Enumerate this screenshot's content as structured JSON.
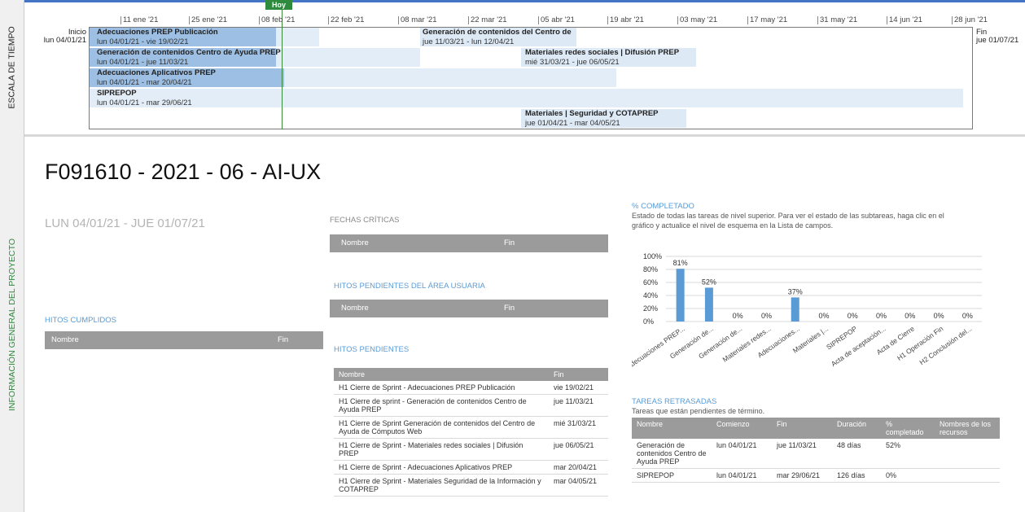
{
  "timeline": {
    "side_label": "ESCALA DE TIEMPO",
    "today_label": "Hoy",
    "start_label": "Inicio",
    "start_date": "lun 04/01/21",
    "end_label": "Fin",
    "end_date": "jue 01/07/21",
    "ticks": [
      "11 ene '21",
      "25 ene '21",
      "08 feb '21",
      "22 feb '21",
      "08 mar '21",
      "22 mar '21",
      "05 abr '21",
      "19 abr '21",
      "03 may '21",
      "17 may '21",
      "31 may '21",
      "14 jun '21",
      "28 jun '21"
    ],
    "tasks": [
      {
        "name": "Adecuaciones PREP Publicación",
        "dates": "lun 04/01/21 - vie 19/02/21"
      },
      {
        "name": "Generación de contenidos del Centro de",
        "dates": "jue 11/03/21 - lun 12/04/21"
      },
      {
        "name": "Generación de contenidos Centro de Ayuda PREP",
        "dates": "lun 04/01/21 - jue 11/03/21"
      },
      {
        "name": "Materiales redes sociales | Difusión PREP",
        "dates": "mié 31/03/21 - jue 06/05/21"
      },
      {
        "name": "Adecuaciones Aplicativos PREP",
        "dates": "lun 04/01/21 - mar 20/04/21"
      },
      {
        "name": "SIPREPOP",
        "dates": "lun 04/01/21 - mar 29/06/21"
      },
      {
        "name": "Materiales | Seguridad y COTAPREP",
        "dates": "jue 01/04/21 - mar 04/05/21"
      }
    ]
  },
  "info": {
    "side_label": "INFORMACIÓN GENERAL DEL PROYECTO",
    "title": "F091610 - 2021 - 06 - AI-UX",
    "date_range": "LUN 04/01/21 -  JUE 01/07/21"
  },
  "hitos_cumplidos": {
    "title": "HITOS CUMPLIDOS",
    "col_name": "Nombre",
    "col_end": "Fin"
  },
  "fechas_criticas": {
    "title": "FECHAS CRÍTICAS",
    "col_name": "Nombre",
    "col_end": "Fin"
  },
  "hitos_usuaria": {
    "title": "HITOS PENDIENTES DEL ÁREA USUARIA",
    "col_name": "Nombre",
    "col_end": "Fin"
  },
  "hitos_pendientes": {
    "title": "HITOS PENDIENTES",
    "col_name": "Nombre",
    "col_end": "Fin",
    "rows": [
      {
        "name": "H1 Cierre de Sprint - Adecuaciones PREP Publicación",
        "end": "vie 19/02/21"
      },
      {
        "name": "H1 Cierre de sprint - Generación de contenidos Centro de Ayuda PREP",
        "end": "jue 11/03/21"
      },
      {
        "name": "H1 Cierre de Sprint Generación de contenidos del Centro de Ayuda de Cómputos Web",
        "end": "mié 31/03/21"
      },
      {
        "name": "H1 Cierre de Sprint - Materiales redes sociales | Difusión PREP",
        "end": "jue 06/05/21"
      },
      {
        "name": "H1 Cierre de Sprint - Adecuaciones Aplicativos PREP",
        "end": "mar 20/04/21"
      },
      {
        "name": "H1 Cierre de Sprint - Materiales Seguridad de la Información y COTAPREP",
        "end": "mar 04/05/21"
      }
    ]
  },
  "completado": {
    "title": "% COMPLETADO",
    "description": "Estado de todas las tareas de nivel superior. Para ver el estado de las subtareas, haga clic en el gráfico y actualice el nivel de esquema en la Lista de campos."
  },
  "chart_data": {
    "type": "bar",
    "categories": [
      "Adecuaciones PREP...",
      "Generación de...",
      "Generación de...",
      "Materiales redes...",
      "Adecuaciones...",
      "Materiales |...",
      "SIPREPOP",
      "Acta de aceptación...",
      "Acta de Cierre",
      "H1 Operación Fin",
      "H2 Conclusión del..."
    ],
    "values": [
      81,
      52,
      0,
      0,
      37,
      0,
      0,
      0,
      0,
      0,
      0
    ],
    "data_labels": [
      "81%",
      "52%",
      "0%",
      "0%",
      "37%",
      "0%",
      "0%",
      "0%",
      "0%",
      "0%",
      "0%"
    ],
    "y_ticks": [
      "100%",
      "80%",
      "60%",
      "40%",
      "20%",
      "0%"
    ],
    "ylim": [
      0,
      100
    ],
    "grid": true,
    "color": "#5b9bd5"
  },
  "tareas_retrasadas": {
    "title": "TAREAS RETRASADAS",
    "subtitle": "Tareas que están pendientes de término.",
    "columns": [
      "Nombre",
      "Comienzo",
      "Fin",
      "Duración",
      "% completado",
      "Nombres de los recursos"
    ],
    "rows": [
      [
        "Generación de contenidos Centro de Ayuda PREP",
        "lun 04/01/21",
        "jue 11/03/21",
        "48 días",
        "52%",
        ""
      ],
      [
        "SIPREPOP",
        "lun 04/01/21",
        "mar 29/06/21",
        "126 días",
        "0%",
        ""
      ]
    ]
  }
}
